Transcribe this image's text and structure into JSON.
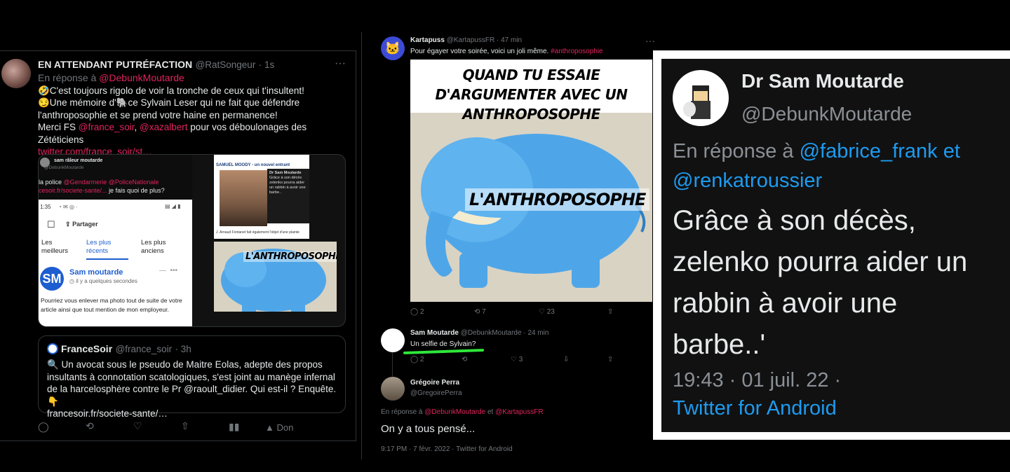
{
  "left_tweet": {
    "name": "EN ATTENDANT PUTRÉFACTION",
    "handle": "@RatSongeur",
    "time": "· 1s",
    "reply_prefix": "En réponse à",
    "reply_to": "@DebunkMoutarde",
    "line1": "🤣C'est toujours rigolo de voir la tronche de ceux qui t'insultent!",
    "line2a": "😏Une mémoire d'",
    "line2b": "ce Sylvain Leser qui ne fait que défendre",
    "line3": "l'anthroposophie et se prend votre haine en permanence!",
    "line4a": "Merci FS",
    "mention_fs": "@france_soir",
    "comma": ",",
    "mention_xaz": "@xazalbert",
    "line4b": "pour vos déboulonages des Zététiciens",
    "link": "twitter.com/france_soir/st…",
    "media": {
      "screen1_name": "sam râleur moutarde",
      "screen1_handle": "@DebunkMoutarde",
      "screen1_line1a": "la police",
      "screen1_m1": "@Gendarmerie",
      "screen1_m2": "@PoliceNationale",
      "screen1_link": "cesoir.fr/societe-sante/...",
      "screen1_line2": "je fais quoi de plus?",
      "phone_time": "1:35",
      "share": "Partager",
      "tab1a": "Les",
      "tab1b": "meilleurs",
      "tab2a": "Les plus",
      "tab2b": "récents",
      "tab3a": "Les plus",
      "tab3b": "anciens",
      "comment_author": "Sam moutarde",
      "comment_time": "il y a quelques secondes",
      "comment_text": "Pourriez vous enlever ma photo tout de suite de votre article ainsi que tout mention de mon employeur.",
      "article_header": "SAMUEL MOODY - un nouvel entrant",
      "article_caption": "J. Arnaud Fontanet fait également l'objet d'une plainte",
      "mini_name": "Dr Sam Moutarde",
      "mini_text": "Grâce à son décès zelenko pourra aider un rabbin à avoir une barbe..",
      "meme_small_label": "L'ANTHROPOSOPHE"
    },
    "quote": {
      "name": "FranceSoir",
      "handle": "@france_soir",
      "time": "· 3h",
      "text": "🔍 Un avocat sous le pseudo de Maitre Eolas, adepte des propos insultants à connotation scatologiques, s'est joint au manège infernal de la harcelosphère contre le Pr @raoult_didier. Qui est-il ? Enquête. 👇",
      "link": "francesoir.fr/societe-sante/…"
    },
    "actions": {
      "don": "Don"
    }
  },
  "mid": {
    "kart": {
      "name": "Kartapuss",
      "handle": "@KartapussFR",
      "time": "· 47 min",
      "text": "Pour égayer votre soirée, voici un joli même.",
      "hashtag": "#anthroposophie",
      "meme_top": "QUAND TU ESSAIE D'ARGUMENTER AVEC UN ANTHROPOSOPHE",
      "meme_label": "L'ANTHROPOSOPHE",
      "replies": "2",
      "retweets": "7",
      "likes": "23"
    },
    "sam": {
      "name": "Sam Moutarde",
      "handle": "@DebunkMoutarde",
      "time": "· 24 min",
      "text": "Un selfie de Sylvain?",
      "replies": "2",
      "likes": "3"
    },
    "greg": {
      "name": "Grégoire Perra",
      "handle": "@GregoirePerra",
      "reply_prefix": "En réponse à",
      "reply_to1": "@DebunkMoutarde",
      "and": "et",
      "reply_to2": "@KartapussFR",
      "text": "On y a tous pensé...",
      "meta": "9:17 PM · 7 févr. 2022 · Twitter for Android"
    }
  },
  "right": {
    "name": "Dr Sam Moutarde",
    "handle": "@DebunkMoutarde",
    "reply_prefix": "En réponse à",
    "reply_to": "@fabrice_frank et",
    "reply_to2": "@renkatroussier",
    "line1": "Grâce à son décès,",
    "line2": "zelenko pourra aider un",
    "line3": "rabbin à avoir une",
    "line4": "barbe..'",
    "meta": "19:43 · 01 juil. 22 ·",
    "client": "Twitter for Android"
  }
}
